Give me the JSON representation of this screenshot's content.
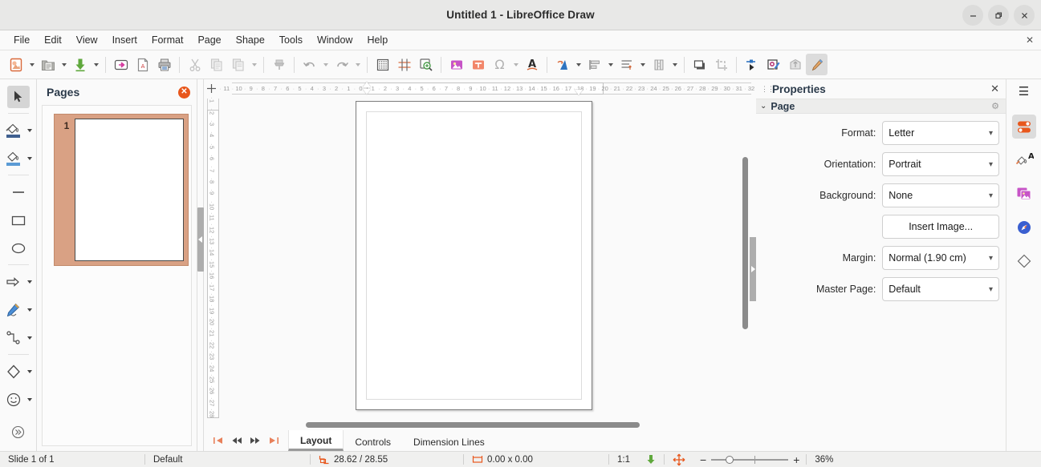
{
  "window": {
    "title": "Untitled 1 - LibreOffice Draw",
    "minimize": "–",
    "maximize": "❐",
    "close": "✕"
  },
  "menubar": {
    "items": [
      {
        "label": "File"
      },
      {
        "label": "Edit"
      },
      {
        "label": "View"
      },
      {
        "label": "Insert"
      },
      {
        "label": "Format"
      },
      {
        "label": "Page"
      },
      {
        "label": "Shape"
      },
      {
        "label": "Tools"
      },
      {
        "label": "Window"
      },
      {
        "label": "Help"
      }
    ],
    "close_doc": "✕"
  },
  "toolbar": {
    "items": [
      {
        "name": "new-document-icon",
        "tip": "New"
      },
      {
        "name": "open-document-icon",
        "tip": "Open"
      },
      {
        "name": "save-icon",
        "tip": "Save"
      },
      {
        "name": "export-directly-as-pdf-icon",
        "tip": "Export as PDF"
      },
      {
        "name": "export-pdf-icon",
        "tip": "Export Directly as PDF"
      },
      {
        "name": "print-icon",
        "tip": "Print"
      },
      {
        "name": "cut-icon",
        "tip": "Cut"
      },
      {
        "name": "copy-icon",
        "tip": "Copy"
      },
      {
        "name": "paste-icon",
        "tip": "Paste"
      },
      {
        "name": "clone-formatting-icon",
        "tip": "Clone Formatting"
      },
      {
        "name": "undo-icon",
        "tip": "Undo"
      },
      {
        "name": "redo-icon",
        "tip": "Redo"
      },
      {
        "name": "display-grid-icon",
        "tip": "Display Grid"
      },
      {
        "name": "helplines-icon",
        "tip": "Helplines While Moving"
      },
      {
        "name": "zoom-icon",
        "tip": "Zoom"
      },
      {
        "name": "insert-image-icon",
        "tip": "Insert Image"
      },
      {
        "name": "insert-text-box-icon",
        "tip": "Insert Text Box"
      },
      {
        "name": "insert-special-character-icon",
        "tip": "Insert Special Character"
      },
      {
        "name": "fontwork-icon",
        "tip": "Insert Fontwork Text"
      },
      {
        "name": "transformations-icon",
        "tip": "Transformations"
      },
      {
        "name": "align-objects-icon",
        "tip": "Align Objects"
      },
      {
        "name": "arrange-icon",
        "tip": "Arrange"
      },
      {
        "name": "distribute-selection-icon",
        "tip": "Distribute Selection"
      },
      {
        "name": "shadow-icon",
        "tip": "Shadow"
      },
      {
        "name": "crop-image-icon",
        "tip": "Crop Image"
      },
      {
        "name": "filter-icon",
        "tip": "Points"
      },
      {
        "name": "show-draw-functions-icon",
        "tip": "Show Draw Functions"
      },
      {
        "name": "3d-objects-icon",
        "tip": "3D Objects"
      },
      {
        "name": "toggle-extrusion-icon",
        "tip": "Toggle Extrusion"
      }
    ]
  },
  "toolrail": {
    "items": [
      {
        "name": "select-tool",
        "label": "Select",
        "active": true
      },
      {
        "name": "fill-color-tool",
        "label": "Fill Color"
      },
      {
        "name": "line-color-tool",
        "label": "Line Color"
      },
      {
        "name": "insert-line-tool",
        "label": "Insert Line"
      },
      {
        "name": "rectangle-tool",
        "label": "Rectangle"
      },
      {
        "name": "ellipse-tool",
        "label": "Ellipse"
      },
      {
        "name": "lines-and-arrows-tool",
        "label": "Lines and Arrows"
      },
      {
        "name": "curves-and-polygons-tool",
        "label": "Curves and Polygons"
      },
      {
        "name": "connectors-tool",
        "label": "Connectors"
      },
      {
        "name": "basic-shapes-tool",
        "label": "Basic Shapes"
      },
      {
        "name": "symbol-shapes-tool",
        "label": "Symbol Shapes"
      },
      {
        "name": "more-tools",
        "label": "More"
      }
    ]
  },
  "pages_panel": {
    "title": "Pages",
    "close": "✕",
    "pages": [
      {
        "number": "1"
      }
    ]
  },
  "ruler": {
    "horizontal_labels": [
      "11",
      "10",
      "9",
      "8",
      "7",
      "6",
      "5",
      "4",
      "3",
      "2",
      "1",
      "0",
      "1",
      "2",
      "3",
      "4",
      "5",
      "6",
      "7",
      "8",
      "9",
      "10",
      "11",
      "12",
      "13",
      "14",
      "15",
      "16",
      "17",
      "18",
      "19",
      "20",
      "21",
      "22",
      "23",
      "24",
      "25",
      "26",
      "27",
      "28",
      "29",
      "30",
      "31",
      "32"
    ],
    "vertical_labels": [
      "1",
      "2",
      "3",
      "4",
      "5",
      "6",
      "7",
      "8",
      "9",
      "10",
      "11",
      "12",
      "13",
      "14",
      "15",
      "16",
      "17",
      "18",
      "19",
      "20",
      "21",
      "22",
      "23",
      "24",
      "25",
      "26",
      "27",
      "28"
    ]
  },
  "layerbar": {
    "nav": [
      {
        "name": "first-page-button",
        "glyph": "|◀"
      },
      {
        "name": "previous-page-button",
        "glyph": "◀◀"
      },
      {
        "name": "next-page-button",
        "glyph": "▶▶"
      },
      {
        "name": "last-page-button",
        "glyph": "▶|"
      }
    ],
    "tabs": [
      {
        "label": "Layout",
        "active": true
      },
      {
        "label": "Controls",
        "active": false
      },
      {
        "label": "Dimension Lines",
        "active": false
      }
    ]
  },
  "sidebar": {
    "title": "Properties",
    "close": "✕",
    "hamburger": "☰",
    "panel": {
      "title": "Page",
      "chevron": "⌄",
      "gear": "⚙"
    },
    "rows": [
      {
        "label": "Format:",
        "value": "Letter",
        "type": "select",
        "name": "page-format-select"
      },
      {
        "label": "Orientation:",
        "value": "Portrait",
        "type": "select",
        "name": "page-orientation-select"
      },
      {
        "label": "Background:",
        "value": "None",
        "type": "select",
        "name": "page-background-select"
      },
      {
        "label": "",
        "value": "Insert Image...",
        "type": "button",
        "name": "insert-image-button"
      },
      {
        "label": "Margin:",
        "value": "Normal (1.90 cm)",
        "type": "select",
        "name": "page-margin-select"
      },
      {
        "label": "Master Page:",
        "value": "Default",
        "type": "select",
        "name": "master-page-select"
      }
    ],
    "rail": [
      {
        "name": "properties-deck-icon",
        "label": "Properties",
        "active": true
      },
      {
        "name": "styles-deck-icon",
        "label": "Styles",
        "active": false
      },
      {
        "name": "gallery-deck-icon",
        "label": "Gallery",
        "active": false
      },
      {
        "name": "navigator-deck-icon",
        "label": "Navigator",
        "active": false
      },
      {
        "name": "shapes-deck-icon",
        "label": "Shapes",
        "active": false
      }
    ]
  },
  "statusbar": {
    "slide_info": "Slide 1 of 1",
    "master": "Default",
    "cursor_position": "28.62 / 28.55",
    "object_size": "0.00 x 0.00",
    "scale": "1:1",
    "zoom_level": "36%",
    "minus": "−",
    "plus": "+"
  },
  "colors": {
    "accent_orange": "#e8571c",
    "titlebar_bg": "#e8e8e7",
    "toolbar_bg": "#fafafa",
    "panel_header_bg": "#ededec",
    "page_thumb": "#d9a184",
    "scrollbar": "#8b8b8b"
  }
}
